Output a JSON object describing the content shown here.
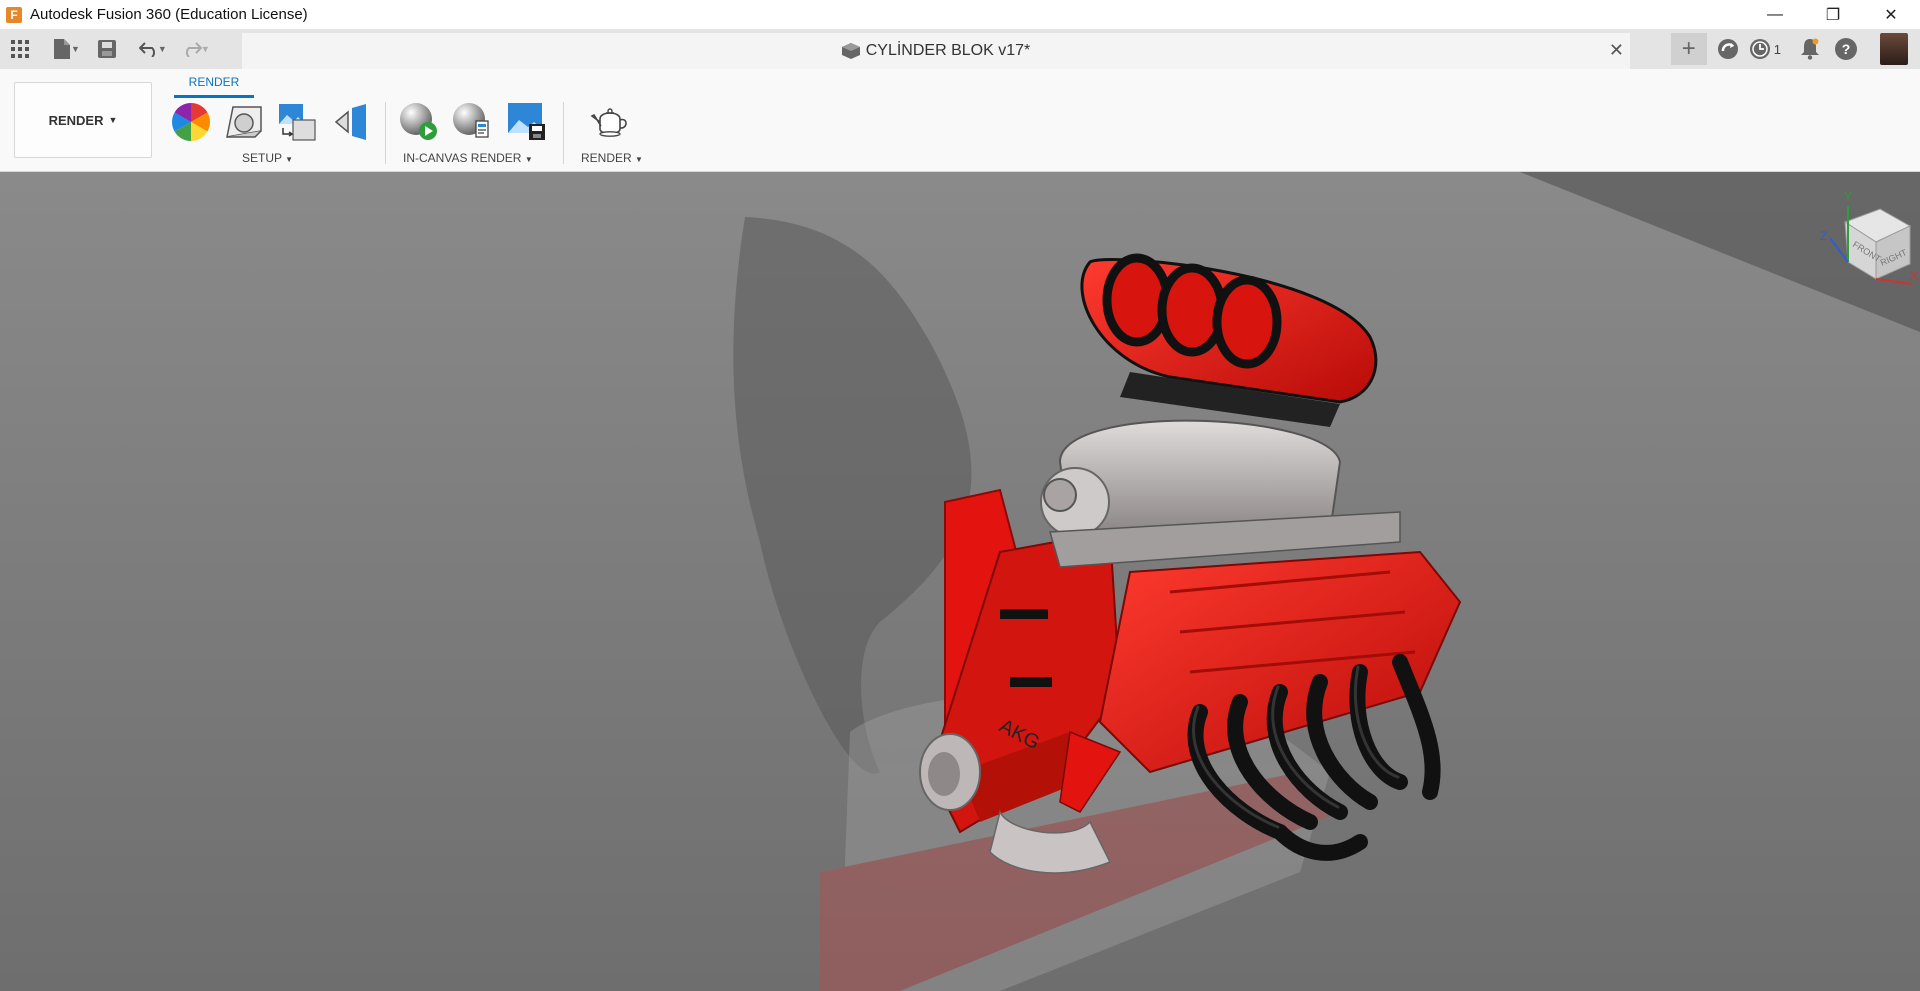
{
  "window": {
    "app_title": "Autodesk Fusion 360 (Education License)",
    "minimize_glyph": "—",
    "restore_glyph": "❐",
    "close_glyph": "✕"
  },
  "tabbar": {
    "document_title": "CYLİNDER BLOK v17*",
    "close_glyph": "✕",
    "plus_glyph": "+",
    "job_count": "1"
  },
  "toolbar": {
    "workspace_label": "RENDER",
    "active_tab": "RENDER",
    "groups": {
      "setup": "SETUP",
      "in_canvas": "IN-CANVAS RENDER",
      "render": "RENDER"
    }
  },
  "viewcube": {
    "front": "FRONT",
    "right": "RIGHT",
    "axis_y": "Y",
    "axis_z": "Z",
    "axis_x": "X"
  },
  "model": {
    "engraving": "AKG"
  },
  "colors": {
    "accent": "#0a74c4",
    "engine_red": "#e3140f",
    "viewport_gray": "#7c7c7c",
    "app_orange": "#e8862a"
  }
}
